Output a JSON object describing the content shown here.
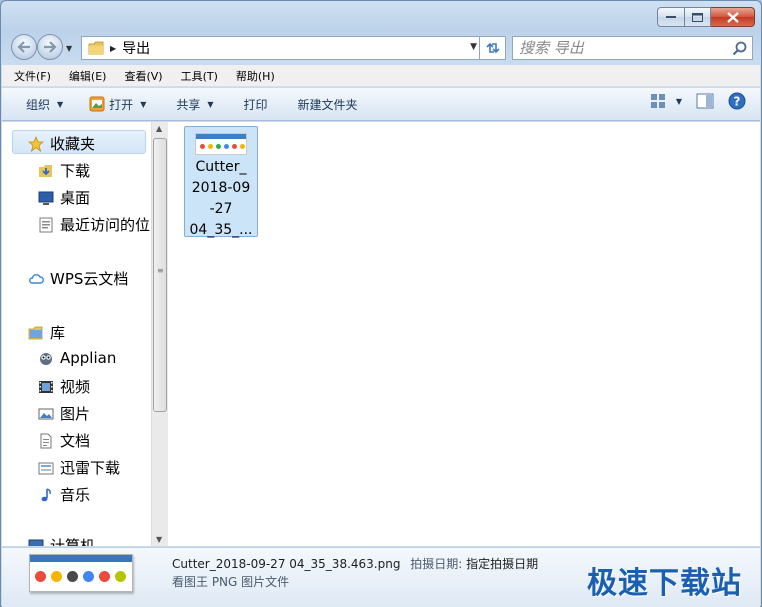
{
  "window": {
    "title": "导出"
  },
  "address": {
    "path": "导出"
  },
  "search": {
    "placeholder": "搜索 导出"
  },
  "menu": [
    "文件(F)",
    "编辑(E)",
    "查看(V)",
    "工具(T)",
    "帮助(H)"
  ],
  "toolbar": {
    "organize": "组织",
    "open": "打开",
    "share": "共享",
    "print": "打印",
    "new_folder": "新建文件夹"
  },
  "nav": {
    "favorites": "收藏夹",
    "fav_items": [
      "下载",
      "桌面",
      "最近访问的位"
    ],
    "wps": "WPS云文档",
    "libraries": "库",
    "lib_items": [
      "Applian",
      "视频",
      "图片",
      "文档",
      "迅雷下载",
      "音乐"
    ],
    "computer": "计算机"
  },
  "file": {
    "tile_name_lines": [
      "Cutter_",
      "2018-09",
      "-27",
      "04_35_..."
    ]
  },
  "details": {
    "filename": "Cutter_2018-09-27 04_35_38.463.png",
    "date_label": "拍摄日期:",
    "date_value": "指定拍摄日期",
    "type": "看图王 PNG 图片文件"
  },
  "watermark": "极速下载站",
  "colors": {
    "accent": "#1a5fb0",
    "selection": "#cce4f7",
    "close": "#c23a22"
  }
}
